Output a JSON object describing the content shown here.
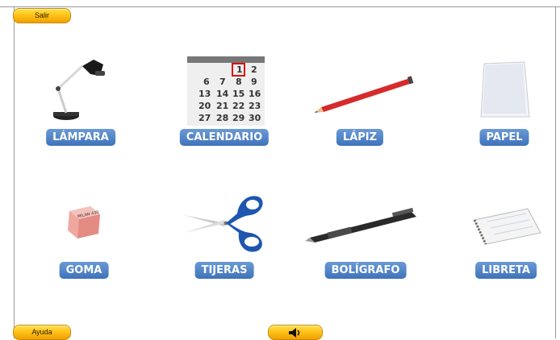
{
  "buttons": {
    "exit_label": "Salir",
    "help_label": "Ayuda",
    "sound_icon": "speaker-icon"
  },
  "items": [
    {
      "label": "LÁMPARA",
      "icon": "lamp-icon"
    },
    {
      "label": "CALENDARIO",
      "icon": "calendar-icon"
    },
    {
      "label": "LÁPIZ",
      "icon": "pencil-icon"
    },
    {
      "label": "PAPEL",
      "icon": "paper-icon"
    },
    {
      "label": "GOMA",
      "icon": "eraser-icon"
    },
    {
      "label": "TIJERAS",
      "icon": "scissors-icon"
    },
    {
      "label": "BOLÍGRAFO",
      "icon": "pen-icon"
    },
    {
      "label": "LIBRETA",
      "icon": "notebook-icon"
    }
  ],
  "calendar_numbers": [
    "1",
    "2",
    "6",
    "7",
    "8",
    "9",
    "13",
    "14",
    "15",
    "16",
    "20",
    "21",
    "22",
    "23",
    "27",
    "28",
    "29",
    "30"
  ],
  "eraser_text": "MILAN 430",
  "colors": {
    "label_bg": "#4a7cc2",
    "button_bg": "#ffc21a",
    "frame": "#9a9a9a"
  }
}
